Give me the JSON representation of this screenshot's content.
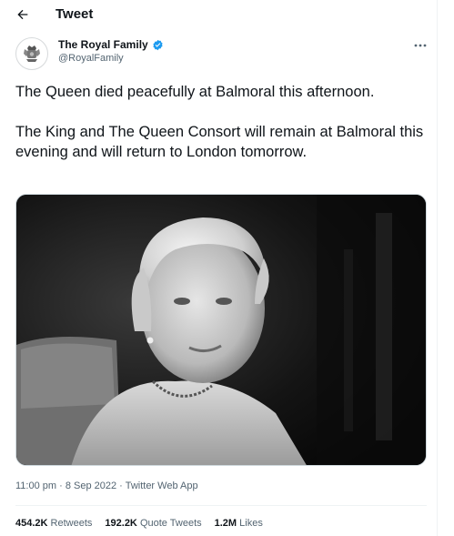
{
  "header": {
    "title": "Tweet",
    "back_icon": "arrow-left-icon"
  },
  "author": {
    "name": "The Royal Family",
    "handle": "@RoyalFamily",
    "verified": true,
    "verified_color": "#1d9bf0",
    "avatar_icon": "royal-crest-icon"
  },
  "tweet": {
    "text": "The Queen died peacefully at Balmoral this afternoon.\n\nThe King and The Queen Consort will remain at Balmoral this evening and will return to London tomorrow.",
    "photo_description": "Black and white portrait photograph",
    "timestamp": "11:00 pm · 8 Sep 2022 · Twitter Web App",
    "time": "11:00 pm",
    "date": "8 Sep 2022",
    "source": "Twitter Web App",
    "sep": " · "
  },
  "stats": {
    "retweets_count": "454.2K",
    "retweets_label": "Retweets",
    "quote_count": "192.2K",
    "quote_label": "Quote Tweets",
    "likes_count": "1.2M",
    "likes_label": "Likes"
  },
  "more_icon": "more-horizontal-icon"
}
